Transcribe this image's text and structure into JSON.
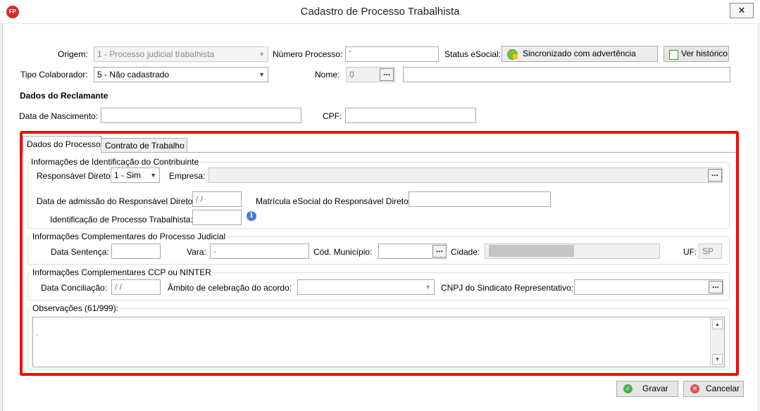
{
  "window": {
    "title": "Cadastro de Processo Trabalhista",
    "close_label": "✕"
  },
  "header": {
    "origem_label": "Origem:",
    "origem_value": "1 - Processo judicial trabalhista",
    "numero_processo_label": "Número Processo:",
    "numero_processo_value": "`",
    "status_esocial_label": "Status eSocial:",
    "status_value": "Sincronizado com advertência",
    "ver_historico_label": "Ver histórico",
    "tipo_colaborador_label": "Tipo Colaborador:",
    "tipo_colaborador_value": "5 - Não cadastrado",
    "nome_label": "Nome:",
    "nome_code": "0",
    "nome_value": "",
    "dados_reclamante": "Dados do Reclamante",
    "data_nascimento_label": "Data de Nascimento:",
    "data_nascimento_value": "",
    "cpf_label": "CPF:",
    "cpf_value": ""
  },
  "tabs": [
    {
      "label": "Dados do Processo",
      "active": true
    },
    {
      "label": "Contrato de Trabalho",
      "active": false
    }
  ],
  "identificacao": {
    "title": "Informações de Identificação do Contribuinte",
    "responsavel_label": "Responsável Direto:",
    "responsavel_value": "1 - Sim",
    "empresa_label": "Empresa:",
    "empresa_value": "",
    "data_admissao_label": "Data de admissão do Responsável Direto:",
    "data_admissao_value": " / /",
    "matricula_label": "Matrícula eSocial do Responsável Direto",
    "matricula_value": "",
    "ident_processo_label": "Identificação de Processo Trabalhista:",
    "ident_processo_value": ""
  },
  "judicial": {
    "title": "Informações Complementares do Processo Judicial",
    "data_sentenca_label": "Data Sentença:",
    "data_sentenca_value": "",
    "vara_label": "Vara:",
    "vara_value": "·",
    "cod_municipio_label": "Cód. Município:",
    "cod_municipio_value": "",
    "cidade_label": "Cidade:",
    "cidade_value": "",
    "uf_label": "UF:",
    "uf_value": "SP"
  },
  "ccp": {
    "title": "Informações Complementares CCP ou NINTER",
    "data_conciliacao_label": "Data Conciliação:",
    "data_conciliacao_value": " / /",
    "ambito_label": "Âmbito de celebração do acordo:",
    "ambito_value": "",
    "cnpj_label": "CNPJ do Sindicato Representativo:",
    "cnpj_value": ""
  },
  "observacoes": {
    "title": "Observações (61/999):",
    "value": ","
  },
  "footer": {
    "gravar_label": "Gravar",
    "cancelar_label": "Cancelar"
  },
  "colors": {
    "highlight": "#ff0000",
    "titlebar": "#ffffff"
  }
}
